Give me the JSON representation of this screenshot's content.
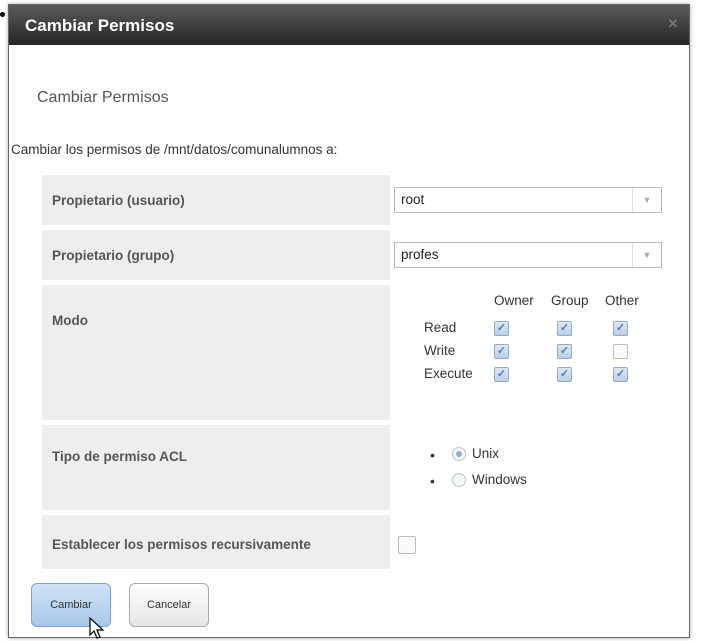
{
  "dialog": {
    "title": "Cambiar Permisos",
    "close_icon": "close-icon"
  },
  "subtitle": "Cambiar Permisos",
  "description": "Cambiar los permisos de /mnt/datos/comunalumnos a:",
  "fields": {
    "owner_user": {
      "label": "Propietario (usuario)",
      "value": "root"
    },
    "owner_group": {
      "label": "Propietario (grupo)",
      "value": "profes"
    },
    "mode": {
      "label": "Modo",
      "columns": [
        "Owner",
        "Group",
        "Other"
      ],
      "rows": [
        {
          "name": "Read",
          "checked": [
            true,
            true,
            true
          ]
        },
        {
          "name": "Write",
          "checked": [
            true,
            true,
            false
          ]
        },
        {
          "name": "Execute",
          "checked": [
            true,
            true,
            true
          ]
        }
      ]
    },
    "acl": {
      "label": "Tipo de permiso ACL",
      "options": [
        "Unix",
        "Windows"
      ],
      "selected": "Unix"
    },
    "recursive": {
      "label": "Establecer los permisos recursivamente",
      "checked": false
    }
  },
  "buttons": {
    "submit": "Cambiar",
    "cancel": "Cancelar"
  },
  "colors": {
    "titlebar": "#262626",
    "label_bg": "#eeeeee",
    "primary_button": "#a8c8ea"
  }
}
